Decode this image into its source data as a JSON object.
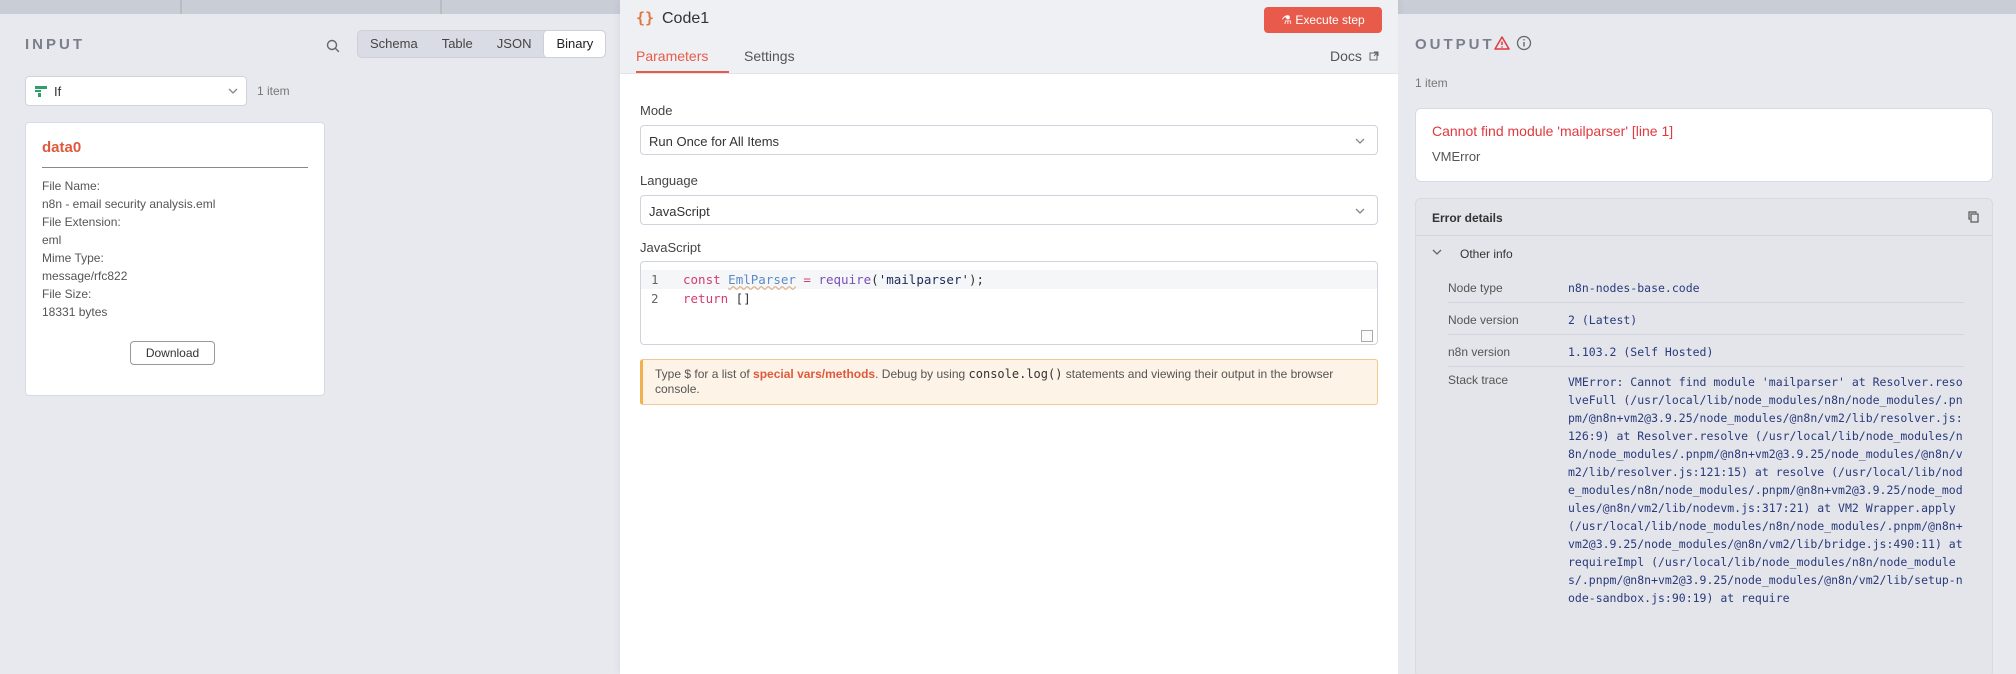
{
  "input": {
    "title": "INPUT",
    "view_tabs": [
      "Schema",
      "Table",
      "JSON",
      "Binary"
    ],
    "active_view": "Binary",
    "node_select": "If",
    "item_count": "1 item",
    "binary": {
      "name": "data0",
      "file_name_label": "File Name:",
      "file_name": "n8n - email security analysis.eml",
      "file_ext_label": "File Extension:",
      "file_ext": "eml",
      "mime_label": "Mime Type:",
      "mime": "message/rfc822",
      "size_label": "File Size:",
      "size": "18331 bytes",
      "download": "Download"
    }
  },
  "node": {
    "icon": "{}",
    "title": "Code1",
    "execute": "Execute step",
    "tabs": [
      "Parameters",
      "Settings"
    ],
    "docs": "Docs",
    "mode_label": "Mode",
    "mode_value": "Run Once for All Items",
    "language_label": "Language",
    "language_value": "JavaScript",
    "code_label": "JavaScript",
    "code": {
      "l1_num": "1",
      "l1_kw": "const",
      "l1_var": "EmlParser",
      "l1_eq": " = ",
      "l1_fn": "require",
      "l1_open": "(",
      "l1_str": "'mailparser'",
      "l1_close": ");",
      "l2_num": "2",
      "l2_kw": "return",
      "l2_rest": " []"
    },
    "hint": {
      "part1": "Type $ for a list of ",
      "highlight": "special vars/methods",
      "part2": ". Debug by using ",
      "mono": "console.log()",
      "part3": " statements and viewing their output in the browser console."
    }
  },
  "output": {
    "title": "OUTPUT",
    "item_count": "1 item",
    "error_message": "Cannot find module 'mailparser' [line 1]",
    "error_type": "VMError",
    "details_header": "Error details",
    "other_info": "Other info",
    "node_type_label": "Node type",
    "node_type": "n8n-nodes-base.code",
    "node_version_label": "Node version",
    "node_version": "2 (Latest)",
    "n8n_version_label": "n8n version",
    "n8n_version": "1.103.2 (Self Hosted)",
    "stack_label": "Stack trace",
    "stack": "VMError: Cannot find module 'mailparser' at Resolver.resolveFull (/usr/local/lib/node_modules/n8n/node_modules/.pnpm/@n8n+vm2@3.9.25/node_modules/@n8n/vm2/lib/resolver.js:126:9) at Resolver.resolve (/usr/local/lib/node_modules/n8n/node_modules/.pnpm/@n8n+vm2@3.9.25/node_modules/@n8n/vm2/lib/resolver.js:121:15) at resolve (/usr/local/lib/node_modules/n8n/node_modules/.pnpm/@n8n+vm2@3.9.25/node_modules/@n8n/vm2/lib/nodevm.js:317:21) at VM2 Wrapper.apply (/usr/local/lib/node_modules/n8n/node_modules/.pnpm/@n8n+vm2@3.9.25/node_modules/@n8n/vm2/lib/bridge.js:490:11) at requireImpl (/usr/local/lib/node_modules/n8n/node_modules/.pnpm/@n8n+vm2@3.9.25/node_modules/@n8n/vm2/lib/setup-node-sandbox.js:90:19) at require"
  },
  "colors": {
    "accent": "#e85b4a",
    "error": "#e0393e",
    "code_icon": "#e0773e"
  }
}
